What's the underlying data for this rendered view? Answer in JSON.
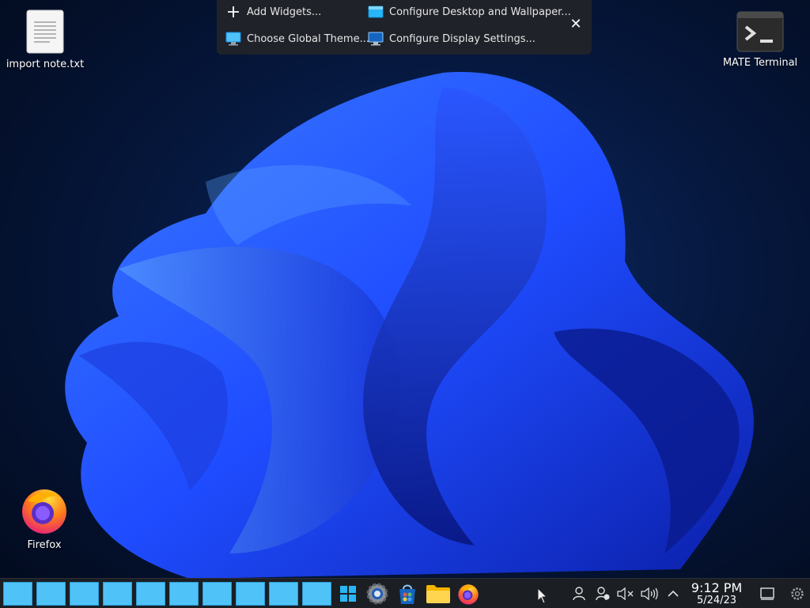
{
  "toolbar": {
    "add_widgets": "Add Widgets...",
    "configure_desktop": "Configure Desktop and Wallpaper...",
    "choose_theme": "Choose Global Theme...",
    "configure_display": "Configure Display Settings...",
    "close_icon": "close-icon"
  },
  "desktop": {
    "icons": [
      {
        "label": "import note.txt",
        "icon": "text-file-icon"
      },
      {
        "label": "MATE Terminal",
        "icon": "terminal-icon"
      },
      {
        "label": "Firefox",
        "icon": "firefox-icon"
      }
    ]
  },
  "taskbar": {
    "virtual_desktops": 10,
    "apps": [
      "start-menu-icon",
      "settings-icon",
      "app-store-icon",
      "file-manager-icon",
      "firefox-icon"
    ],
    "tray": [
      "user-icon",
      "user-switch-icon",
      "mute-icon",
      "volume-icon",
      "expand-tray-icon"
    ],
    "clock": {
      "time": "9:12 PM",
      "date": "5/24/23"
    }
  },
  "colors": {
    "accent": "#4fc3f7",
    "panel": "#1b1f24",
    "wallpaper_blue": "#1f4cff"
  }
}
